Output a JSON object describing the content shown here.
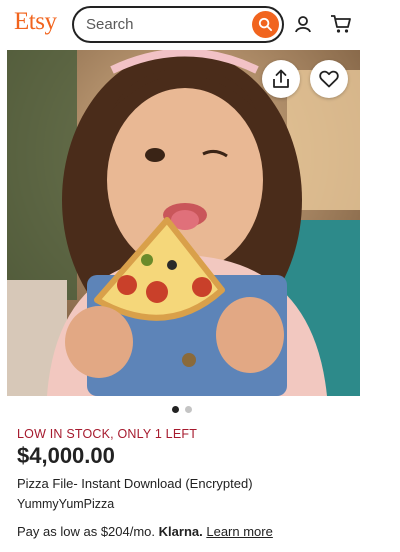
{
  "header": {
    "logo": "Etsy",
    "search_placeholder": "Search",
    "search_icon": "search-icon",
    "account_icon": "user-icon",
    "cart_icon": "cart-icon"
  },
  "gallery": {
    "image_description_icon": "product-photo",
    "share_icon": "share-icon",
    "favorite_icon": "heart-icon",
    "dot_count": 2,
    "active_dot": 0
  },
  "listing": {
    "stock_notice": "LOW IN STOCK, ONLY 1 LEFT",
    "price": "$4,000.00",
    "title": "Pizza File- Instant Download (Encrypted)",
    "shop_name": "YummyYumPizza",
    "pay_prefix": "Pay as low as $204/mo.",
    "pay_provider": "Klarna.",
    "learn_more": "Learn more"
  },
  "colors": {
    "brand": "#f1641e",
    "stock_notice": "#a61a2e",
    "text": "#222222"
  }
}
